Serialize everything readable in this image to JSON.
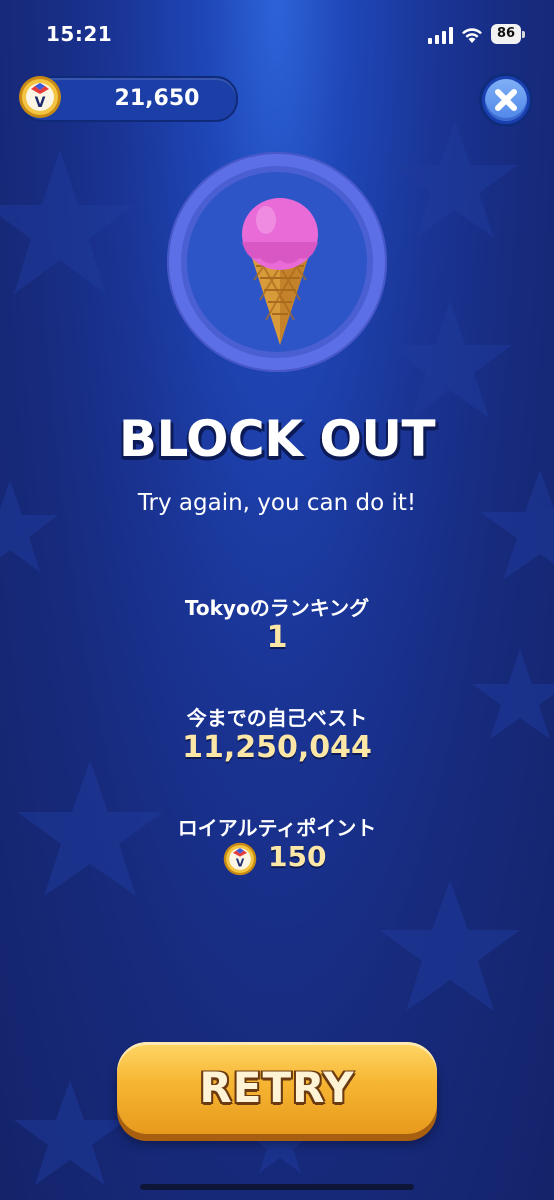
{
  "status_bar": {
    "time": "15:21",
    "battery": "86"
  },
  "header": {
    "coin_balance": "21,650",
    "coin_letter": "V"
  },
  "game": {
    "title": "BLOCK OUT",
    "subtitle": "Try again, you can do it!"
  },
  "stats": {
    "ranking_label": "Tokyoのランキング",
    "ranking_value": "1",
    "best_label": "今までの自己ベスト",
    "best_value": "11,250,044",
    "loyalty_label": "ロイアルティポイント",
    "loyalty_value": "150"
  },
  "buttons": {
    "retry_label": "RETRY"
  },
  "icons": {
    "badge": "ice-cream-cone-icon",
    "close": "close-icon",
    "coin": "v-coin-icon"
  },
  "colors": {
    "background": "#1a3596",
    "accent_gold": "#f6b532",
    "value_text": "#fde7a6"
  }
}
